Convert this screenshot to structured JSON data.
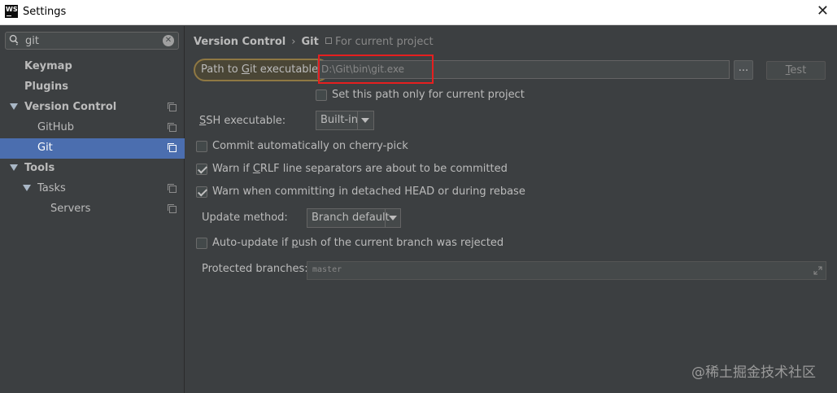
{
  "window": {
    "title": "Settings",
    "logo_text": "WS",
    "close_glyph": "✕"
  },
  "search": {
    "value": "git",
    "clear_glyph": "✕"
  },
  "sidebar": {
    "items": [
      {
        "label": "Keymap",
        "bold": true
      },
      {
        "label": "Plugins",
        "bold": true
      },
      {
        "label": "Version Control",
        "bold": true,
        "expanded": true
      },
      {
        "label": "GitHub",
        "bold": false
      },
      {
        "label": "Git",
        "bold": false,
        "selected": true
      },
      {
        "label": "Tools",
        "bold": true,
        "expanded": true
      },
      {
        "label": "Tasks",
        "bold": false,
        "expanded": true
      },
      {
        "label": "Servers",
        "bold": false
      }
    ]
  },
  "breadcrumb": {
    "parent": "Version Control",
    "separator": "›",
    "current": "Git",
    "scope": "For current project"
  },
  "path": {
    "label_pre": "Path to ",
    "label_mnemonic": "G",
    "label_post": "it executable:",
    "value": "D:\\Git\\bin\\git.exe",
    "browse_label": "...",
    "test_label_mnemonic": "T",
    "test_label_rest": "est",
    "only_current_project": "Set this path only for current project"
  },
  "ssh": {
    "label_mnemonic": "S",
    "label_rest": "SH executable:",
    "value": "Built-in"
  },
  "options": {
    "cherry_pick": {
      "label": "Commit automatically on cherry-pick",
      "checked": false
    },
    "crlf": {
      "label_pre": "Warn if ",
      "label_mnemonic": "C",
      "label_post": "RLF line separators are about to be committed",
      "checked": true
    },
    "detached": {
      "label": "Warn when committing in detached HEAD or during rebase",
      "checked": true
    }
  },
  "update": {
    "label": "Update method:",
    "value": "Branch default"
  },
  "auto_update": {
    "label_pre": "Auto-update if ",
    "label_mnemonic": "p",
    "label_post": "ush of the current branch was rejected",
    "checked": false
  },
  "protected": {
    "label": "Protected branches:",
    "value": "master"
  },
  "watermark": "@稀土掘金技术社区"
}
